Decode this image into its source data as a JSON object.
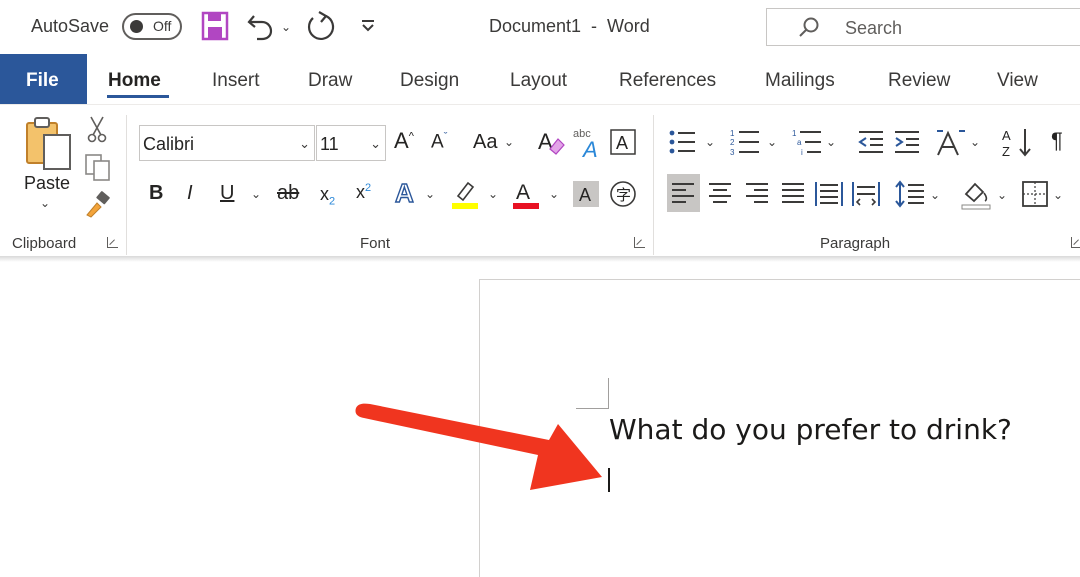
{
  "titlebar": {
    "autosave_label": "AutoSave",
    "autosave_state": "Off",
    "document_title": "Document1  -  Word",
    "search_placeholder": "Search",
    "icons": [
      "save-icon",
      "undo-icon",
      "redo-icon",
      "customize-qat-icon",
      "search-icon"
    ]
  },
  "tabs": {
    "file": "File",
    "items": [
      "Home",
      "Insert",
      "Draw",
      "Design",
      "Layout",
      "References",
      "Mailings",
      "Review",
      "View"
    ],
    "active": "Home"
  },
  "ribbon": {
    "clipboard": {
      "label": "Clipboard",
      "paste_label": "Paste"
    },
    "font": {
      "label": "Font",
      "font_name": "Calibri",
      "font_size": "11",
      "bold": "B",
      "italic": "I",
      "underline": "U",
      "strike": "ab",
      "change_case": "Aa",
      "highlight_color": "#ffff00",
      "font_color": "#e81123"
    },
    "paragraph": {
      "label": "Paragraph",
      "active_alignment": "align-left"
    }
  },
  "document": {
    "text_line": "What do you prefer to drink?"
  },
  "colors": {
    "word_blue": "#2b579a",
    "accent_purple": "#b146c2",
    "arrow_red": "#f0351f"
  }
}
